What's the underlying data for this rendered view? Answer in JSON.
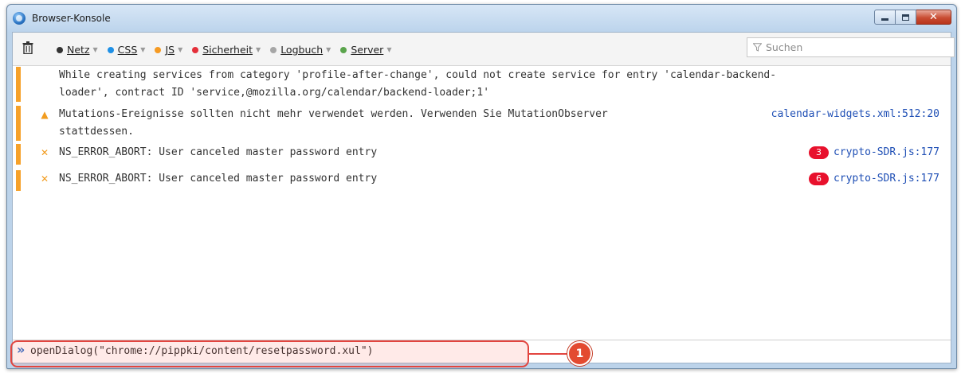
{
  "window": {
    "title": "Browser-Konsole",
    "close_color": "#c94d33"
  },
  "toolbar": {
    "filters": [
      {
        "label": "Netz",
        "color": "#333333"
      },
      {
        "label": "CSS",
        "color": "#1e90e6"
      },
      {
        "label": "JS",
        "color": "#f59a23"
      },
      {
        "label": "Sicherheit",
        "color": "#e4303a"
      },
      {
        "label": "Logbuch",
        "color": "#a6a6a6"
      },
      {
        "label": "Server",
        "color": "#5aa44c"
      }
    ],
    "search_placeholder": "Suchen"
  },
  "log": [
    {
      "severity": "",
      "message": "While creating services from category 'profile-after-change', could not create service for entry 'calendar-backend-\nloader', contract ID 'service,@mozilla.org/calendar/backend-loader;1'",
      "count": "",
      "source": ""
    },
    {
      "severity": "warning",
      "message": "Mutations-Ereignisse sollten nicht mehr verwendet werden. Verwenden Sie MutationObserver\nstattdessen.",
      "count": "",
      "source": "calendar-widgets.xml:512:20"
    },
    {
      "severity": "error",
      "message": "NS_ERROR_ABORT: User canceled master password entry",
      "count": "3",
      "source": "crypto-SDR.js:177"
    },
    {
      "severity": "error",
      "message": "NS_ERROR_ABORT: User canceled master password entry",
      "count": "6",
      "source": "crypto-SDR.js:177"
    }
  ],
  "command": {
    "prompt": "»",
    "value": "openDialog(\"chrome://pippki/content/resetpassword.xul\")"
  },
  "annotation": {
    "number": "1",
    "color": "#e2453f"
  }
}
